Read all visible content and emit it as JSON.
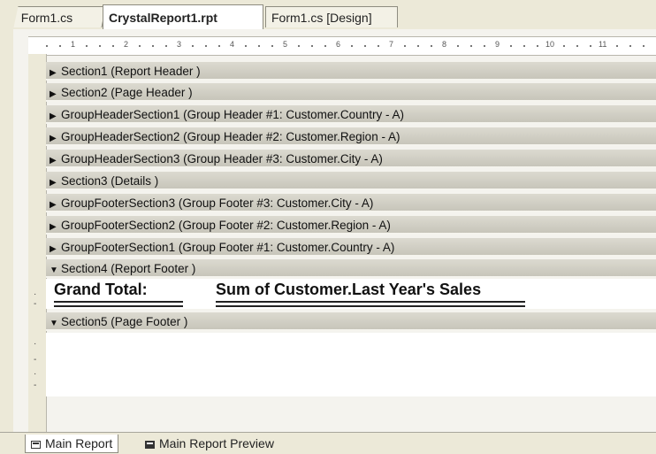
{
  "doc_tabs": [
    {
      "label": "Form1.cs",
      "active": false
    },
    {
      "label": "CrystalReport1.rpt",
      "active": true
    },
    {
      "label": "Form1.cs [Design]",
      "active": false
    }
  ],
  "ruler": {
    "marks": [
      "1",
      "2",
      "3",
      "4",
      "5",
      "6",
      "7",
      "8",
      "9",
      "10",
      "11"
    ]
  },
  "sections": [
    {
      "label": "Section1 (Report Header )",
      "expanded": false
    },
    {
      "label": "Section2 (Page Header )",
      "expanded": false
    },
    {
      "label": "GroupHeaderSection1 (Group Header #1: Customer.Country - A)",
      "expanded": false
    },
    {
      "label": "GroupHeaderSection2 (Group Header #2: Customer.Region - A)",
      "expanded": false
    },
    {
      "label": "GroupHeaderSection3 (Group Header #3: Customer.City - A)",
      "expanded": false
    },
    {
      "label": "Section3 (Details )",
      "expanded": false
    },
    {
      "label": "GroupFooterSection3 (Group Footer #3: Customer.City - A)",
      "expanded": false
    },
    {
      "label": "GroupFooterSection2 (Group Footer #2: Customer.Region - A)",
      "expanded": false
    },
    {
      "label": "GroupFooterSection1 (Group Footer #1: Customer.Country - A)",
      "expanded": false
    },
    {
      "label": "Section4 (Report Footer )",
      "expanded": true
    },
    {
      "label": "Section5 (Page Footer )",
      "expanded": true
    }
  ],
  "report_footer": {
    "grand_total_label": "Grand Total:",
    "sum_field": "Sum of Customer.Last Year's Sales"
  },
  "bottom_tabs": [
    {
      "label": "Main Report",
      "active": true,
      "icon": "report-icon"
    },
    {
      "label": "Main Report Preview",
      "active": false,
      "icon": "preview-icon"
    }
  ]
}
